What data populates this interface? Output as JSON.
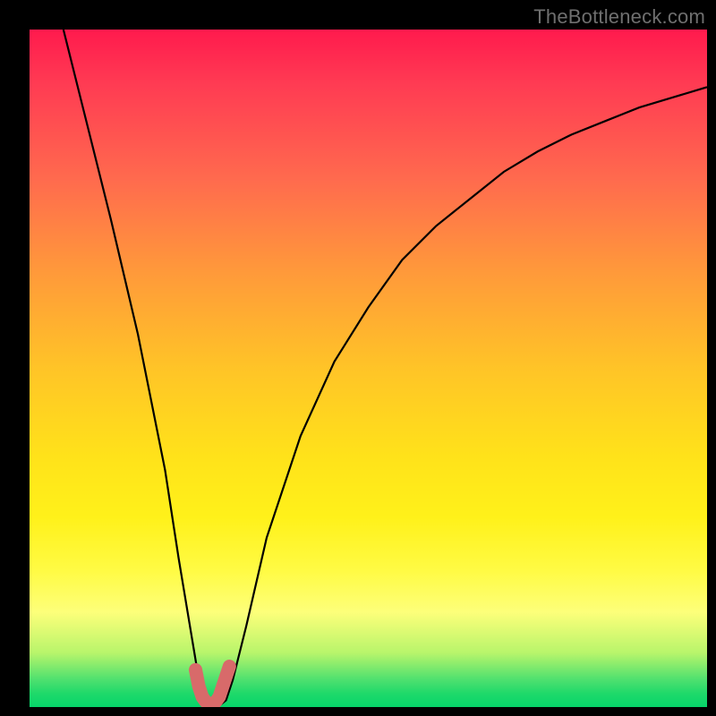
{
  "watermark": "TheBottleneck.com",
  "chart_data": {
    "type": "line",
    "title": "",
    "xlabel": "",
    "ylabel": "",
    "xlim": [
      0,
      100
    ],
    "ylim": [
      0,
      100
    ],
    "series": [
      {
        "name": "bottleneck-curve",
        "x": [
          5,
          8,
          12,
          16,
          20,
          22,
          24,
          25,
          26,
          27,
          28,
          29,
          30,
          32,
          35,
          40,
          45,
          50,
          55,
          60,
          65,
          70,
          75,
          80,
          85,
          90,
          95,
          100
        ],
        "values": [
          100,
          88,
          72,
          55,
          35,
          22,
          10,
          4,
          1,
          0.2,
          0.2,
          1,
          4,
          12,
          25,
          40,
          51,
          59,
          66,
          71,
          75,
          79,
          82,
          84.5,
          86.5,
          88.5,
          90,
          91.5
        ]
      },
      {
        "name": "flat-bottom-marker",
        "x": [
          24.5,
          25,
          25.5,
          26,
          26.5,
          27,
          27.5,
          28,
          28.5,
          29,
          29.5
        ],
        "values": [
          5.5,
          3,
          1.5,
          0.8,
          0.5,
          0.5,
          0.8,
          1.5,
          3,
          4.5,
          6
        ]
      }
    ],
    "background_gradient": {
      "top": "#ff1a4d",
      "mid": "#ffe21a",
      "bottom": "#06d46a"
    },
    "marker_color": "#d86a6a",
    "curve_color": "#000000"
  }
}
